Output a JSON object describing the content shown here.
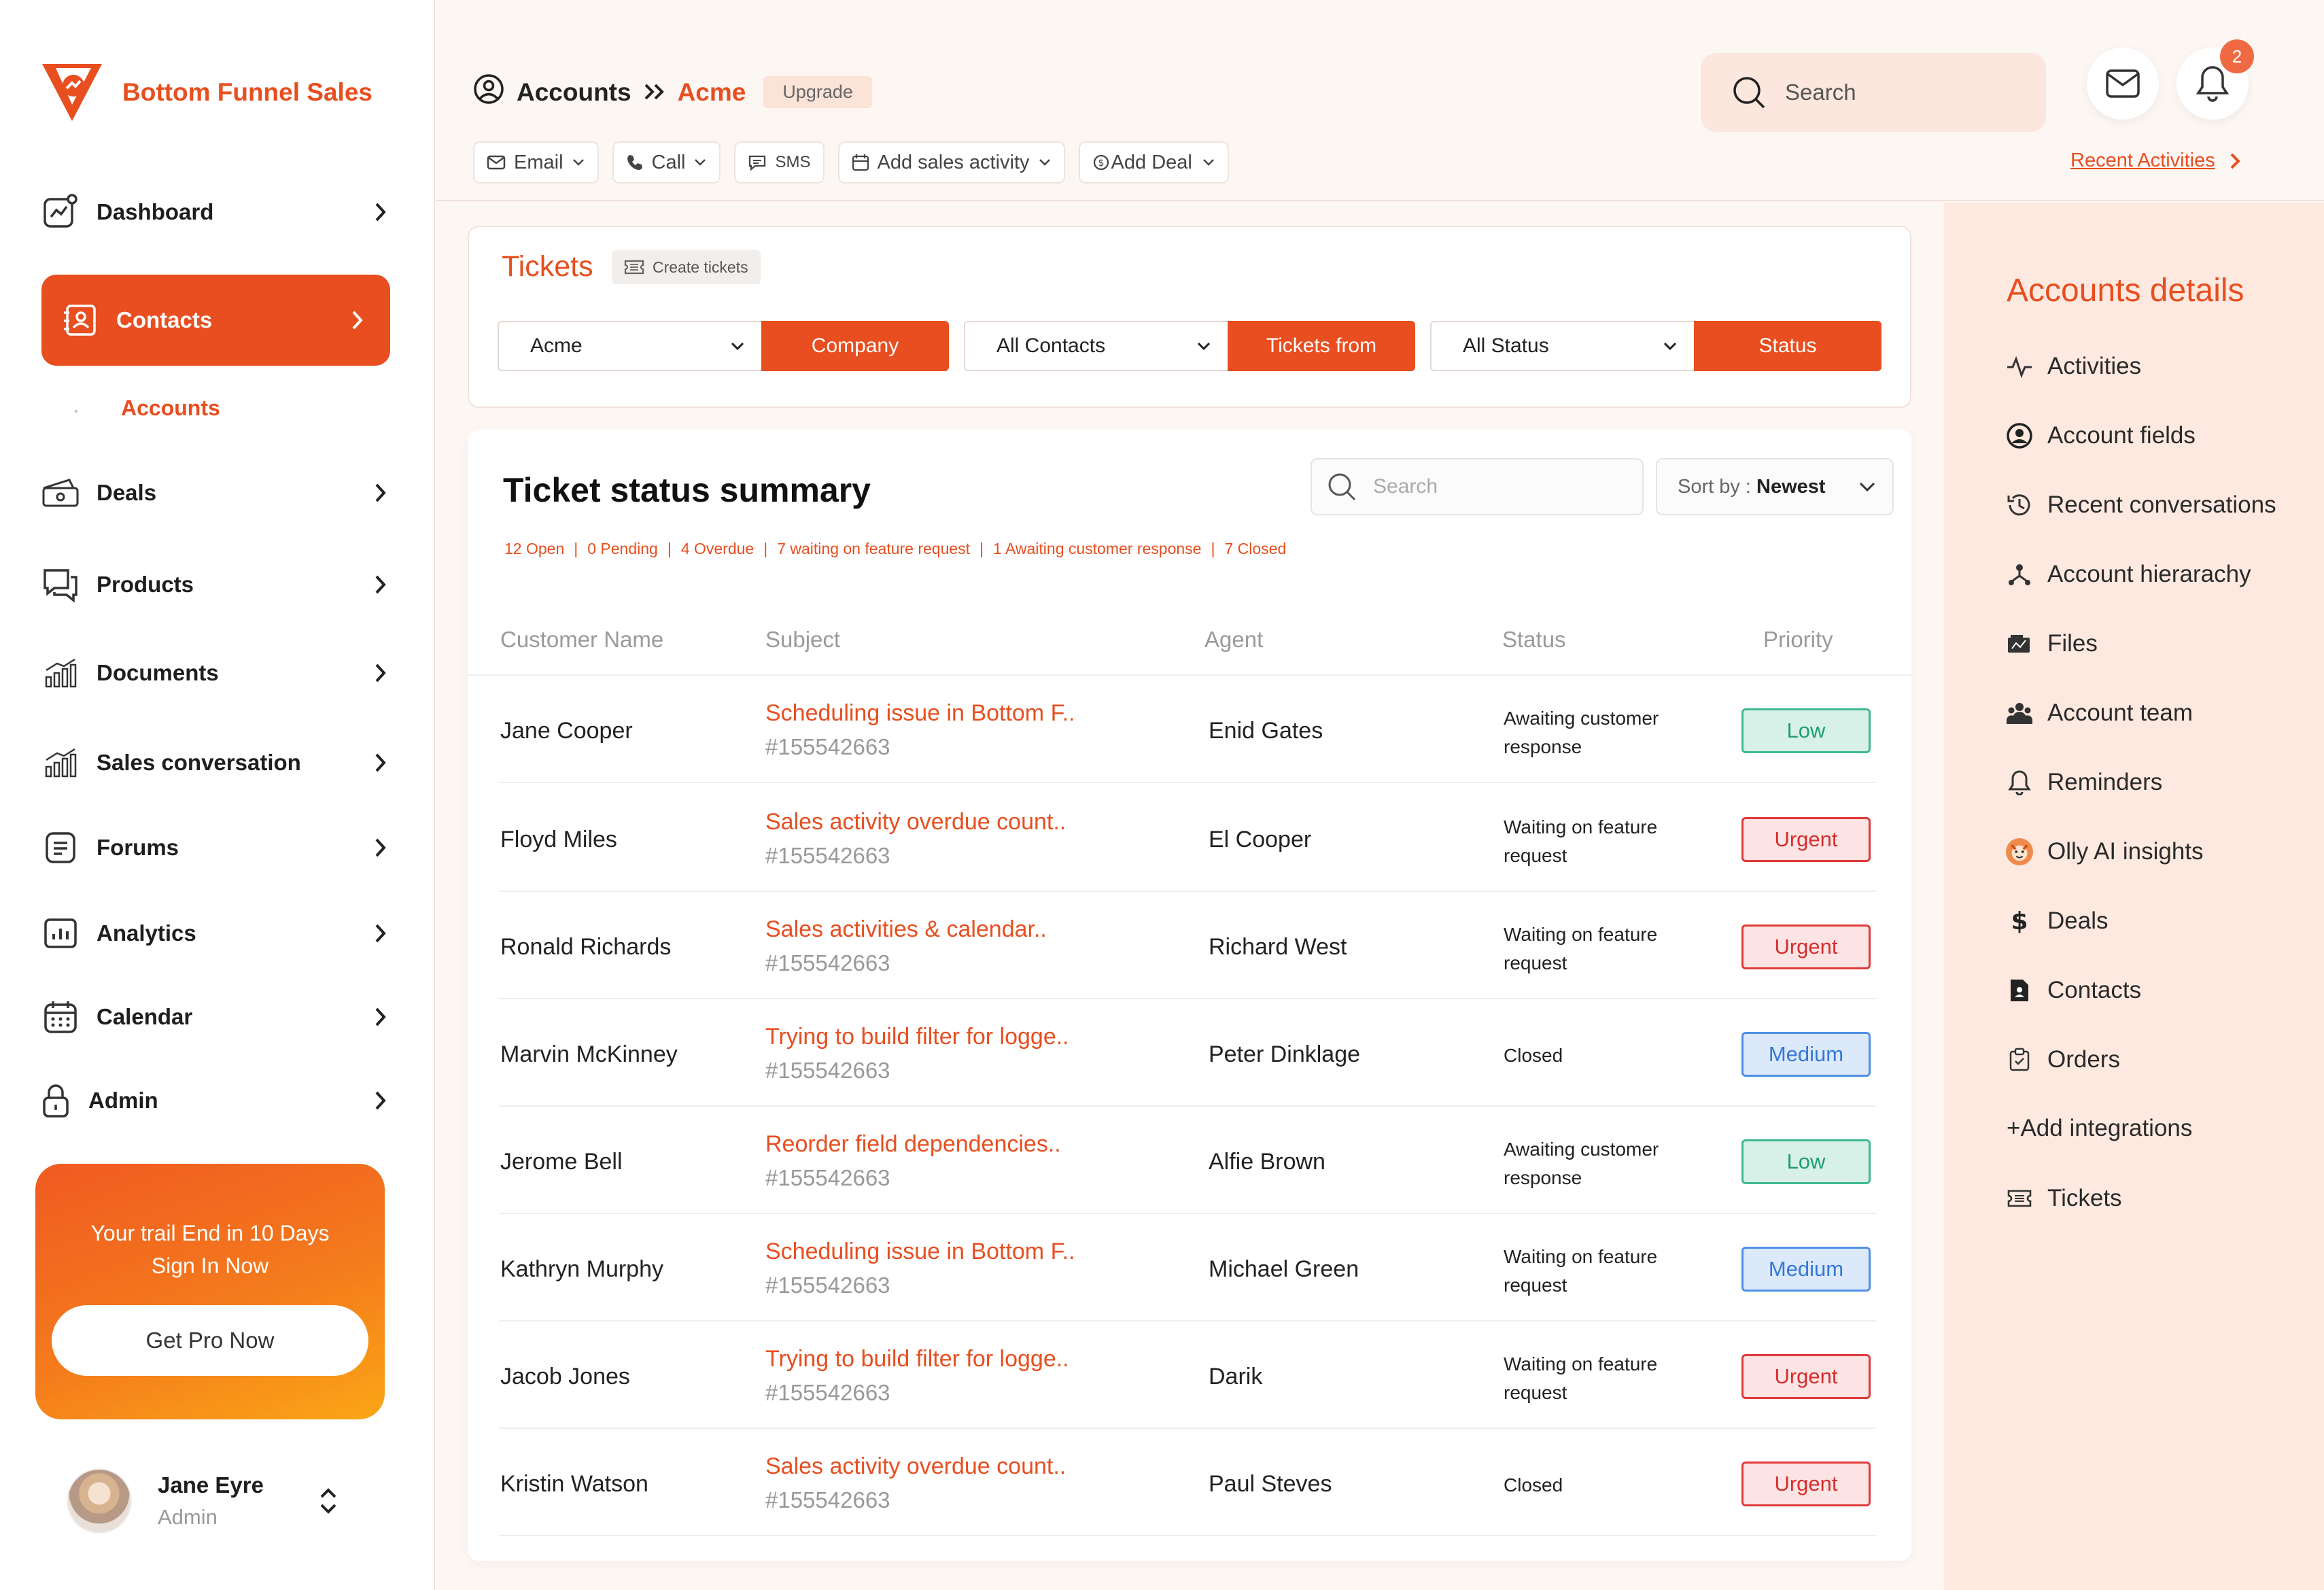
{
  "brand": {
    "name": "Bottom Funnel Sales",
    "accent": "#e84e1f"
  },
  "sidebar": {
    "items": [
      {
        "label": "Dashboard",
        "icon": "dashboard-icon"
      },
      {
        "label": "Contacts",
        "icon": "contacts-icon",
        "active": true
      },
      {
        "label": "Deals",
        "icon": "deals-icon"
      },
      {
        "label": "Products",
        "icon": "products-icon"
      },
      {
        "label": "Documents",
        "icon": "documents-icon"
      },
      {
        "label": "Sales conversation",
        "icon": "sales-conversation-icon"
      },
      {
        "label": "Forums",
        "icon": "forums-icon"
      },
      {
        "label": "Analytics",
        "icon": "analytics-icon"
      },
      {
        "label": "Calendar",
        "icon": "calendar-icon"
      },
      {
        "label": "Admin",
        "icon": "lock-icon"
      }
    ],
    "sub_item": "Accounts",
    "promo": {
      "line1": "Your trail End in 10 Days",
      "line2": "Sign In Now",
      "button": "Get Pro Now"
    },
    "user": {
      "name": "Jane Eyre",
      "role": "Admin"
    }
  },
  "header": {
    "breadcrumb_root": "Accounts",
    "breadcrumb_current": "Acme",
    "upgrade": "Upgrade",
    "actions": {
      "email": "Email",
      "call": "Call",
      "sms": "SMS",
      "add_sales_activity": "Add sales activity",
      "add_deal": "Add Deal"
    },
    "search_placeholder": "Search",
    "notification_count": "2",
    "recent_activities": "Recent Activities"
  },
  "tickets": {
    "title": "Tickets",
    "create": "Create tickets",
    "filters": [
      {
        "value": "Acme",
        "button": "Company"
      },
      {
        "value": "All Contacts",
        "button": "Tickets from"
      },
      {
        "value": "All Status",
        "button": "Status"
      }
    ]
  },
  "summary": {
    "title": "Ticket status summary",
    "search_placeholder": "Search",
    "sort_label": "Sort by : ",
    "sort_value": "Newest",
    "stats": [
      "12 Open",
      "0 Pending",
      "4 Overdue",
      "7 waiting on feature request",
      "1 Awaiting customer response",
      "7 Closed"
    ],
    "columns": [
      "Customer Name",
      "Subject",
      "Agent",
      "Status",
      "Priority"
    ],
    "rows": [
      {
        "customer": "Jane Cooper",
        "subject": "Scheduling issue in Bottom F..",
        "id": "#155542663",
        "agent": "Enid Gates",
        "status": "Awaiting customer response",
        "priority": "Low"
      },
      {
        "customer": "Floyd Miles",
        "subject": "Sales activity overdue count..",
        "id": "#155542663",
        "agent": "El Cooper",
        "status": "Waiting on feature request",
        "priority": "Urgent"
      },
      {
        "customer": "Ronald Richards",
        "subject": "Sales activities & calendar..",
        "id": "#155542663",
        "agent": "Richard West",
        "status": "Waiting on feature request",
        "priority": "Urgent"
      },
      {
        "customer": "Marvin McKinney",
        "subject": "Trying to build filter for logge..",
        "id": "#155542663",
        "agent": "Peter Dinklage",
        "status": "Closed",
        "priority": "Medium"
      },
      {
        "customer": "Jerome Bell",
        "subject": "Reorder field dependencies..",
        "id": "#155542663",
        "agent": "Alfie Brown",
        "status": "Awaiting customer response",
        "priority": "Low"
      },
      {
        "customer": "Kathryn Murphy",
        "subject": "Scheduling issue in Bottom F..",
        "id": "#155542663",
        "agent": "Michael Green",
        "status": "Waiting on feature request",
        "priority": "Medium"
      },
      {
        "customer": "Jacob Jones",
        "subject": "Trying to build filter for logge..",
        "id": "#155542663",
        "agent": "Darik",
        "status": "Waiting on feature request",
        "priority": "Urgent"
      },
      {
        "customer": "Kristin Watson",
        "subject": "Sales activity overdue count..",
        "id": "#155542663",
        "agent": "Paul Steves",
        "status": "Closed",
        "priority": "Urgent"
      }
    ]
  },
  "details": {
    "title": "Accounts details",
    "items": [
      {
        "label": "Activities",
        "icon": "activity-icon"
      },
      {
        "label": "Account fields",
        "icon": "user-circle-icon"
      },
      {
        "label": "Recent conversations",
        "icon": "history-icon"
      },
      {
        "label": "Account hierarachy",
        "icon": "hierarchy-icon"
      },
      {
        "label": "Files",
        "icon": "files-icon"
      },
      {
        "label": "Account team",
        "icon": "team-icon"
      },
      {
        "label": "Reminders",
        "icon": "bell-icon"
      },
      {
        "label": "Olly AI insights",
        "icon": "olly-avatar-icon"
      },
      {
        "label": "Deals",
        "icon": "dollar-icon"
      },
      {
        "label": "Contacts",
        "icon": "contact-file-icon"
      },
      {
        "label": "Orders",
        "icon": "orders-icon"
      },
      {
        "label": "+Add integrations",
        "icon": ""
      },
      {
        "label": "Tickets",
        "icon": "ticket-icon"
      }
    ]
  }
}
